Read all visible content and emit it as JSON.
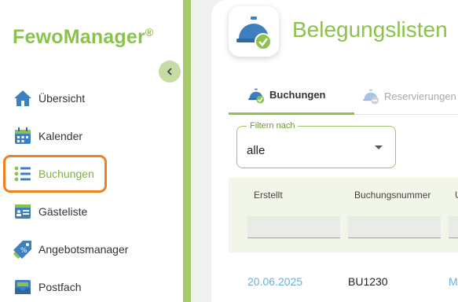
{
  "app": {
    "logo_text_a": "Fewo",
    "logo_text_b": "Manager",
    "logo_reg": "®"
  },
  "sidebar": {
    "items": [
      {
        "label": "Übersicht",
        "icon": "home-icon"
      },
      {
        "label": "Kalender",
        "icon": "calendar-icon"
      },
      {
        "label": "Buchungen",
        "icon": "list-icon",
        "active": true
      },
      {
        "label": "Gästeliste",
        "icon": "guestlist-icon"
      },
      {
        "label": "Angebotsmanager",
        "icon": "tag-icon"
      },
      {
        "label": "Postfach",
        "icon": "inbox-icon"
      }
    ]
  },
  "main": {
    "title": "Belegungslisten",
    "tabs": [
      {
        "label": "Buchungen",
        "active": true
      },
      {
        "label": "Reservierungen",
        "active": false
      }
    ],
    "filter": {
      "legend": "Filtern nach",
      "value": "alle"
    },
    "table": {
      "columns": [
        "Erstellt",
        "Buchungsnummer",
        "U"
      ],
      "rows": [
        {
          "erstellt": "20.06.2025",
          "buchungsnummer": "BU1230",
          "third": "M"
        }
      ]
    }
  },
  "colors": {
    "accent": "#8bc34a",
    "highlight": "#f07f1d",
    "link": "#6aaedc"
  }
}
